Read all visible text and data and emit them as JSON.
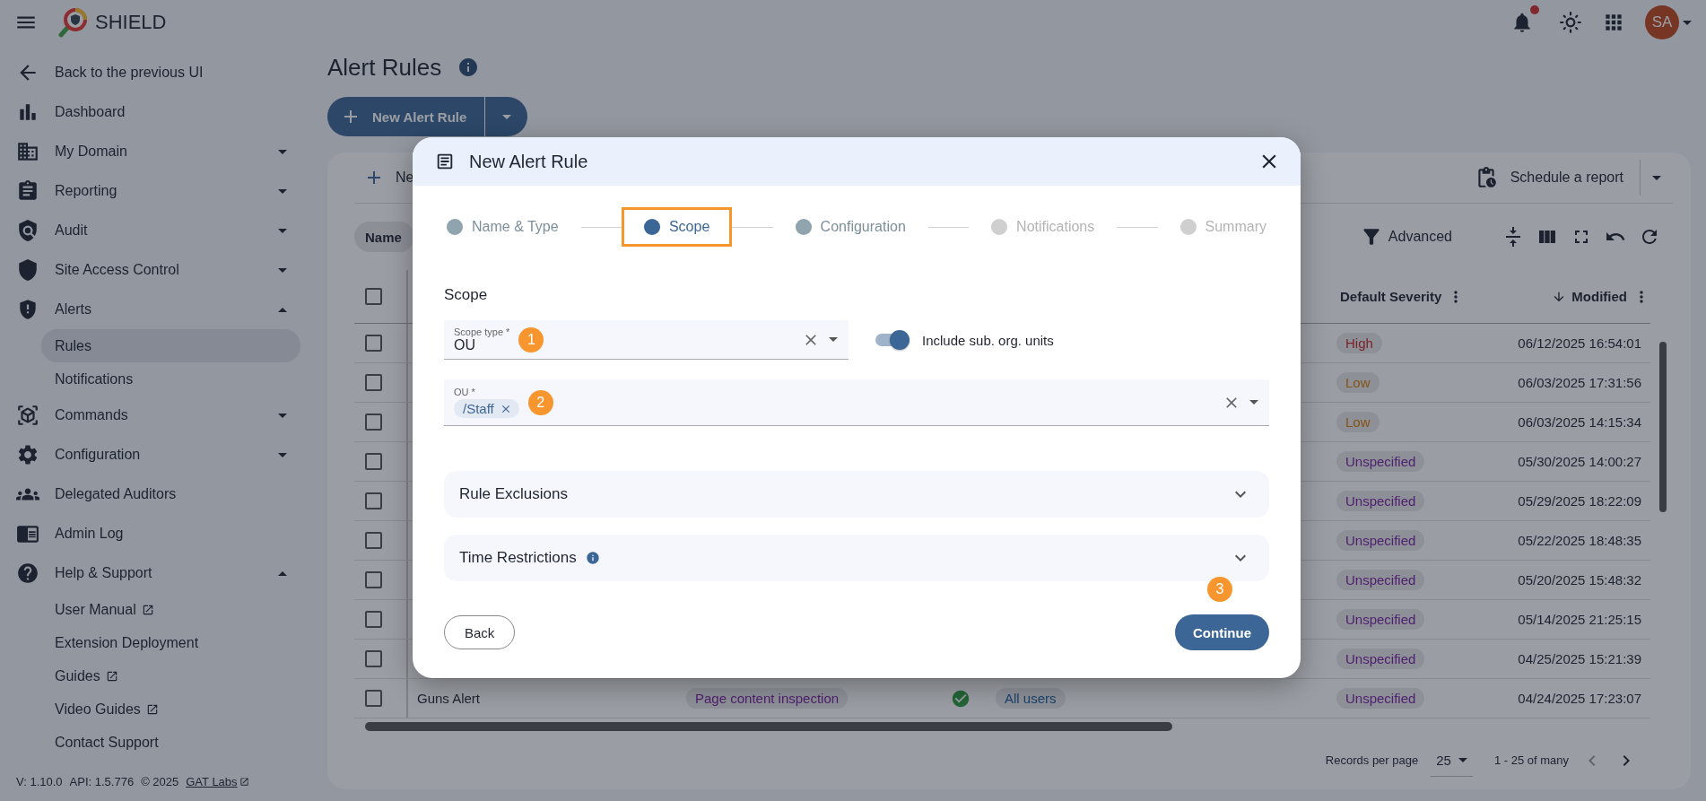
{
  "header": {
    "title": "SHIELD",
    "notification_dot": true,
    "avatar": "SA"
  },
  "sidebar": {
    "items": [
      {
        "label": "Back to the previous UI"
      },
      {
        "label": "Dashboard"
      },
      {
        "label": "My Domain",
        "expanded": false
      },
      {
        "label": "Reporting",
        "expanded": false
      },
      {
        "label": "Audit",
        "expanded": false
      },
      {
        "label": "Site Access Control",
        "expanded": false
      },
      {
        "label": "Alerts",
        "expanded": true,
        "children": [
          {
            "label": "Rules",
            "selected": true,
            "external": false
          },
          {
            "label": "Notifications",
            "selected": false,
            "external": false
          }
        ]
      },
      {
        "label": "Commands",
        "expanded": false
      },
      {
        "label": "Configuration",
        "expanded": false
      },
      {
        "label": "Delegated Auditors"
      },
      {
        "label": "Admin Log"
      },
      {
        "label": "Help & Support",
        "expanded": true,
        "children": [
          {
            "label": "User Manual",
            "selected": false,
            "external": true
          },
          {
            "label": "Extension Deployment",
            "selected": false,
            "external": false
          },
          {
            "label": "Guides",
            "selected": false,
            "external": true
          },
          {
            "label": "Video Guides",
            "selected": false,
            "external": true
          },
          {
            "label": "Contact Support",
            "selected": false,
            "external": false
          }
        ]
      }
    ],
    "footer": {
      "version": "V: 1.10.0",
      "api": "API: 1.5.776",
      "copyright": "© 2025",
      "link": "GAT Labs"
    }
  },
  "page": {
    "title": "Alert Rules",
    "new_button": "New Alert Rule"
  },
  "table_card": {
    "toolbar_button": "Ne",
    "schedule_button": "Schedule a report",
    "filter_chip": "Name",
    "advanced_button": "Advanced",
    "select_all_checked": false,
    "columns": [
      {
        "label": "Default Severity",
        "sorted": false
      },
      {
        "label": "Modified",
        "sorted": true
      }
    ],
    "rows": [
      {
        "checked": false,
        "severity": "High",
        "kind": "high",
        "modified": "06/12/2025 16:54:01"
      },
      {
        "checked": false,
        "severity": "Low",
        "kind": "low",
        "modified": "06/03/2025 17:31:56"
      },
      {
        "checked": false,
        "severity": "Low",
        "kind": "low",
        "modified": "06/03/2025 14:15:34"
      },
      {
        "checked": false,
        "severity": "Unspecified",
        "kind": "unspecified",
        "modified": "05/30/2025 14:00:27"
      },
      {
        "checked": false,
        "severity": "Unspecified",
        "kind": "unspecified",
        "modified": "05/29/2025 18:22:09"
      },
      {
        "checked": false,
        "severity": "Unspecified",
        "kind": "unspecified",
        "modified": "05/22/2025 18:48:35"
      },
      {
        "checked": false,
        "severity": "Unspecified",
        "kind": "unspecified",
        "modified": "05/20/2025 15:48:32"
      },
      {
        "checked": false,
        "severity": "Unspecified",
        "kind": "unspecified",
        "modified": "05/14/2025 21:25:15"
      },
      {
        "checked": false,
        "severity": "Unspecified",
        "kind": "unspecified",
        "modified": "04/25/2025 15:21:39"
      },
      {
        "checked": false,
        "name": "Guns Alert",
        "type": "Page content inspection",
        "enabled": true,
        "scope": "All users",
        "severity": "Unspecified",
        "kind": "unspecified",
        "modified": "04/24/2025 17:23:07"
      }
    ],
    "pagination": {
      "label": "Records per page",
      "per_page": "25",
      "range": "1 - 25 of many"
    }
  },
  "modal": {
    "title": "New Alert Rule",
    "steps": [
      {
        "label": "Name & Type",
        "selected": false,
        "visited": true,
        "highlighted": false
      },
      {
        "label": "Scope",
        "selected": true,
        "highlighted": true
      },
      {
        "label": "Configuration",
        "selected": false,
        "visited": true,
        "highlighted": false
      },
      {
        "label": "Notifications",
        "selected": false,
        "visited": false,
        "highlighted": false
      },
      {
        "label": "Summary",
        "selected": false,
        "visited": false,
        "highlighted": false
      }
    ],
    "section": "Scope",
    "scope_type": {
      "label": "Scope type *",
      "value": "OU",
      "callout": "1"
    },
    "include_sub": {
      "label": "Include sub. org. units",
      "on": true
    },
    "ou": {
      "label": "OU *",
      "chips": [
        "/Staff"
      ],
      "callout": "2"
    },
    "accordions": [
      {
        "label": "Rule Exclusions",
        "expanded": false,
        "info": false
      },
      {
        "label": "Time Restrictions",
        "expanded": false,
        "info": true
      }
    ],
    "back_button": "Back",
    "continue_button": "Continue",
    "continue_callout": "3"
  }
}
